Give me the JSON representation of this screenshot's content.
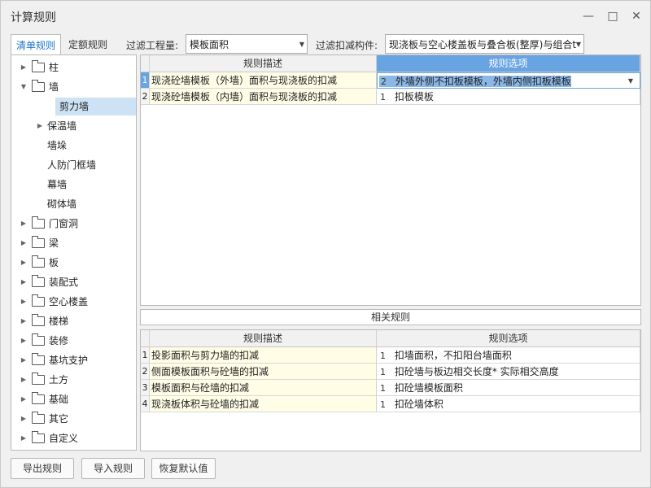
{
  "window": {
    "title": "计算规则",
    "minimize_icon": "minimize-icon",
    "maximize_icon": "maximize-icon",
    "close_icon": "close-icon"
  },
  "tabs": [
    {
      "label": "清单规则",
      "active": true
    },
    {
      "label": "定额规则",
      "active": false
    }
  ],
  "filters": {
    "quantity_label": "过滤工程量:",
    "quantity_value": "模板面积",
    "component_label": "过滤扣减构件:",
    "component_value": "现浇板与空心楼盖板与叠合板(整厚)与组合t"
  },
  "tree": [
    {
      "label": "柱",
      "expandable": true,
      "expanded": false,
      "folder": true
    },
    {
      "label": "墙",
      "expandable": true,
      "expanded": true,
      "folder": true
    },
    {
      "label": "剪力墙",
      "selected": true
    },
    {
      "label": "保温墙",
      "expandable": true,
      "expanded": false
    },
    {
      "label": "墙垛"
    },
    {
      "label": "人防门框墙"
    },
    {
      "label": "幕墙"
    },
    {
      "label": "砌体墙"
    },
    {
      "label": "门窗洞",
      "expandable": true,
      "folder": true
    },
    {
      "label": "梁",
      "expandable": true,
      "folder": true
    },
    {
      "label": "板",
      "expandable": true,
      "folder": true
    },
    {
      "label": "装配式",
      "expandable": true,
      "folder": true
    },
    {
      "label": "空心楼盖",
      "expandable": true,
      "folder": true
    },
    {
      "label": "楼梯",
      "expandable": true,
      "folder": true
    },
    {
      "label": "装修",
      "expandable": true,
      "folder": true
    },
    {
      "label": "基坑支护",
      "expandable": true,
      "folder": true
    },
    {
      "label": "土方",
      "expandable": true,
      "folder": true
    },
    {
      "label": "基础",
      "expandable": true,
      "folder": true
    },
    {
      "label": "其它",
      "expandable": true,
      "folder": true
    },
    {
      "label": "自定义",
      "expandable": true,
      "folder": true
    }
  ],
  "rules_grid": {
    "headers": [
      "规则描述",
      "规则选项"
    ],
    "rows": [
      {
        "no": "1",
        "desc": "现浇砼墙模板（外墙）面积与现浇板的扣减",
        "opt_no": "2",
        "opt": "外墙外侧不扣板模板，外墙内侧扣板模板"
      },
      {
        "no": "2",
        "desc": "现浇砼墙模板（内墙）面积与现浇板的扣减",
        "opt_no": "1",
        "opt": "扣板模板"
      }
    ]
  },
  "related": {
    "title": "相关规则",
    "headers": [
      "规则描述",
      "规则选项"
    ],
    "rows": [
      {
        "no": "1",
        "desc": "投影面积与剪力墙的扣减",
        "opt_no": "1",
        "opt": "扣墙面积，不扣阳台墙面积"
      },
      {
        "no": "2",
        "desc": "侧面模板面积与砼墙的扣减",
        "opt_no": "1",
        "opt": "扣砼墙与板边相交长度* 实际相交高度"
      },
      {
        "no": "3",
        "desc": "模板面积与砼墙的扣减",
        "opt_no": "1",
        "opt": "扣砼墙模板面积"
      },
      {
        "no": "4",
        "desc": "现浇板体积与砼墙的扣减",
        "opt_no": "1",
        "opt": "扣砼墙体积"
      }
    ]
  },
  "buttons": {
    "export": "导出规则",
    "import": "导入规则",
    "restore": "恢复默认值"
  }
}
